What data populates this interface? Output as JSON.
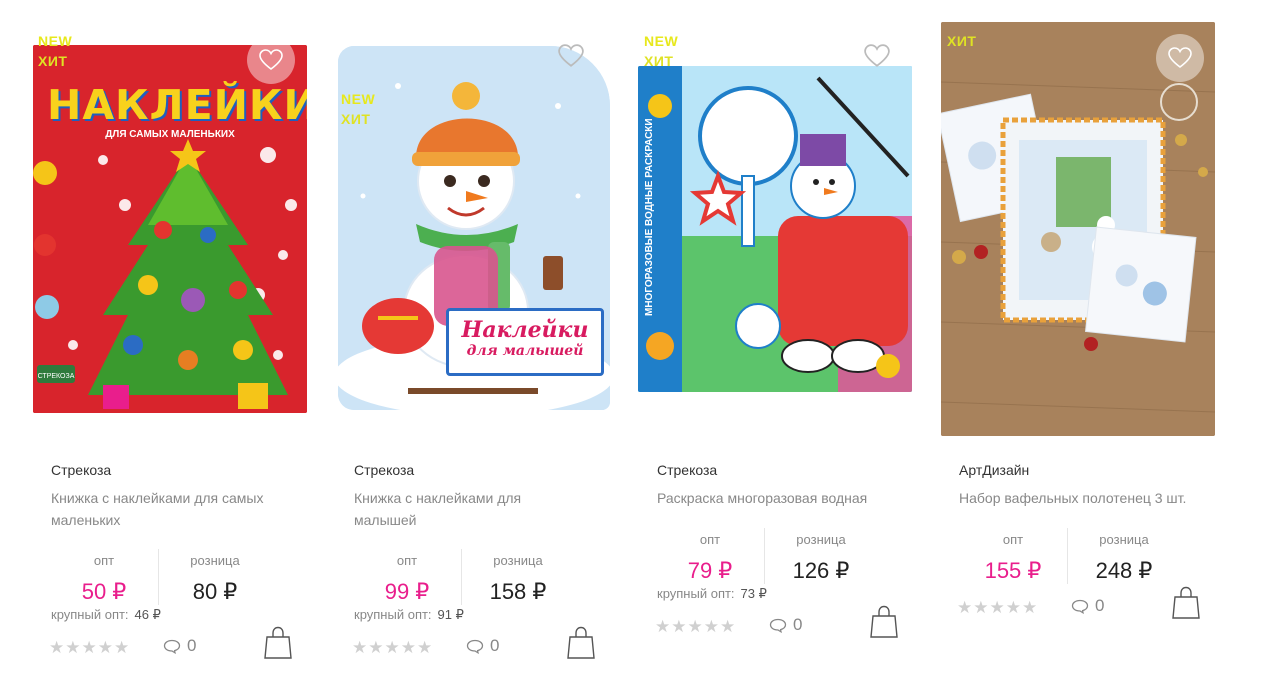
{
  "labels": {
    "opt": "опт",
    "retail": "розница",
    "bulk": "крупный опт:"
  },
  "badges": {
    "new": "NEW",
    "hit": "ХИТ"
  },
  "cover_texts": {
    "p1_title": "НАКЛЕЙКИ",
    "p1_sub": "ДЛЯ САМЫХ МАЛЕНЬКИХ",
    "p1_publisher": "СТРЕКОЗА",
    "p2_title": "Наклейки",
    "p2_sub": "для малышей",
    "p3_side": "МНОГОРАЗОВЫЕ ВОДНЫЕ РАСКРАСКИ"
  },
  "products": [
    {
      "brand": "Стрекоза",
      "title": "Книжка с наклейками для самых маленьких",
      "price_opt": "50 ₽",
      "price_retail": "80 ₽",
      "bulk_price": "46 ₽",
      "comments": "0",
      "rating": 0,
      "badges": [
        "NEW",
        "ХИТ"
      ]
    },
    {
      "brand": "Стрекоза",
      "title": "Книжка с наклейками для малышей",
      "price_opt": "99 ₽",
      "price_retail": "158 ₽",
      "bulk_price": "91 ₽",
      "comments": "0",
      "rating": 0,
      "badges": [
        "NEW",
        "ХИТ"
      ]
    },
    {
      "brand": "Стрекоза",
      "title": "Раскраска многоразовая водная",
      "price_opt": "79 ₽",
      "price_retail": "126 ₽",
      "bulk_price": "73 ₽",
      "comments": "0",
      "rating": 0,
      "badges": [
        "NEW",
        "ХИТ"
      ]
    },
    {
      "brand": "АртДизайн",
      "title": "Набор вафельных полотенец 3 шт.",
      "price_opt": "155 ₽",
      "price_retail": "248 ₽",
      "comments": "0",
      "rating": 0,
      "badges": [
        "ХИТ"
      ]
    }
  ],
  "colors": {
    "accent_price": "#e91e8c",
    "badge": "#e7e81c",
    "stars": "#d0d0d0"
  }
}
